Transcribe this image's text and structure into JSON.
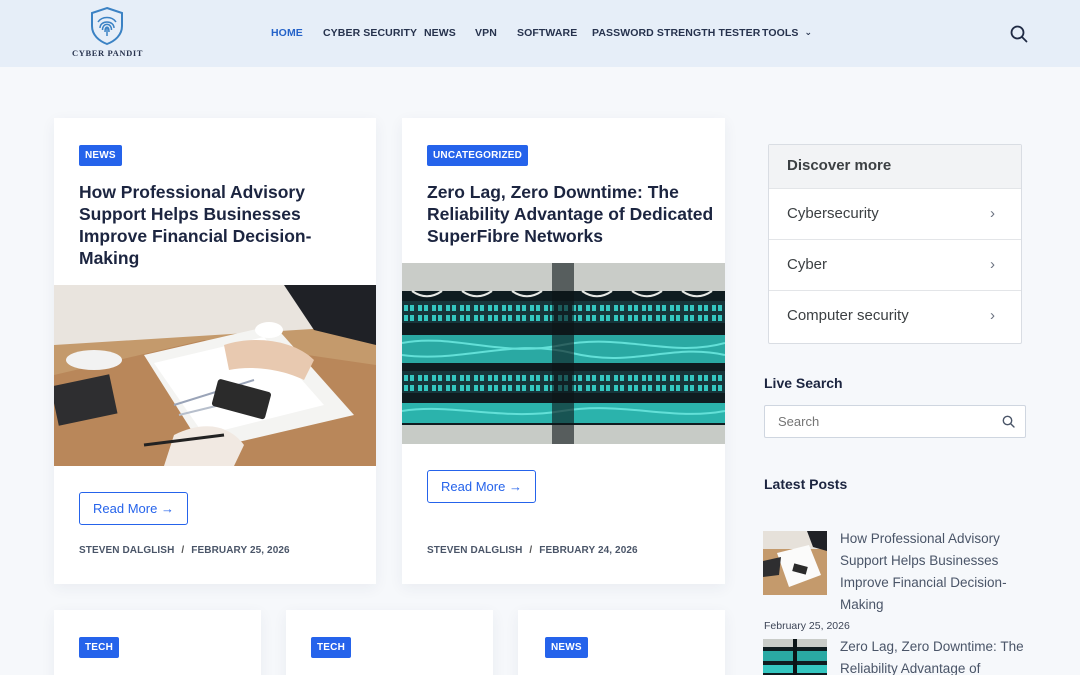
{
  "site": {
    "logo_text": "CYBER PANDIT"
  },
  "nav": {
    "items": [
      {
        "label": "HOME"
      },
      {
        "label": "CYBER SECURITY"
      },
      {
        "label": "NEWS"
      },
      {
        "label": "VPN"
      },
      {
        "label": "SOFTWARE"
      },
      {
        "label": "PASSWORD STRENGTH TESTER"
      },
      {
        "label": "TOOLS"
      }
    ],
    "tools_chevron": "⌄"
  },
  "posts": [
    {
      "category": "NEWS",
      "title": "How Professional Advisory Support Helps Businesses Improve Financial Decision-Making",
      "read_more": "Read More",
      "author": "STEVEN DALGLISH",
      "date": "FEBRUARY 25, 2026"
    },
    {
      "category": "UNCATEGORIZED",
      "title": "Zero Lag, Zero Downtime: The Reliability Advantage of Dedicated SuperFibre Networks",
      "read_more": "Read More",
      "author": "STEVEN DALGLISH",
      "date": "FEBRUARY 24, 2026"
    }
  ],
  "lower_cards": [
    {
      "category": "TECH"
    },
    {
      "category": "TECH"
    },
    {
      "category": "NEWS"
    }
  ],
  "sidebar": {
    "discover": {
      "heading": "Discover more",
      "items": [
        {
          "label": "Cybersecurity"
        },
        {
          "label": "Cyber"
        },
        {
          "label": "Computer security"
        }
      ]
    },
    "live_search": {
      "heading": "Live Search",
      "placeholder": "Search"
    },
    "latest_posts": {
      "heading": "Latest Posts",
      "items": [
        {
          "title": "How Professional Advisory Support Helps Businesses Improve Financial Decision-Making",
          "date": "February 25, 2026"
        },
        {
          "title": "Zero Lag, Zero Downtime: The Reliability Advantage of",
          "date": ""
        }
      ]
    }
  },
  "colors": {
    "accent": "#2563eb",
    "header_bg": "#e6eef8",
    "page_bg": "#f6f8fb"
  }
}
